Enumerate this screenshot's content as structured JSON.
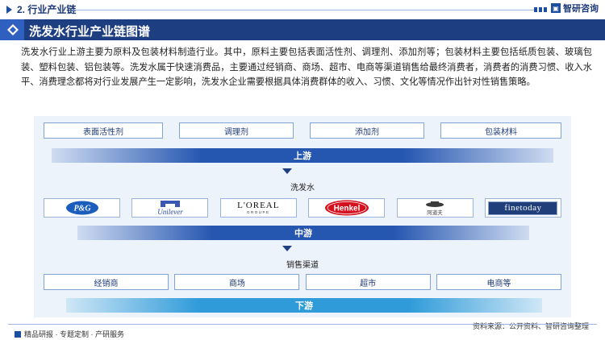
{
  "header": {
    "section_title": "2. 行业产业链",
    "brand": "智研咨询"
  },
  "banner": {
    "title": "洗发水行业产业链图谱"
  },
  "intro": "洗发水行业上游主要为原料及包装材料制造行业。其中，原料主要包括表面活性剂、调理剂、添加剂等；包装材料主要包括纸质包装、玻璃包装、塑料包装、铝包装等。洗发水属于快速消费品，主要通过经销商、商场、超市、电商等渠道销售给最终消费者，消费者的消费习惯、收入水平、消费理念都将对行业发展产生一定影响，洗发水企业需要根据具体消费群体的收入、习惯、文化等情况作出针对性销售策略。",
  "diagram": {
    "upstream_items": [
      "表面活性剂",
      "调理剂",
      "添加剂",
      "包装材料"
    ],
    "upstream_label": "上游",
    "product_label": "洗发水",
    "companies": [
      "P&G",
      "Unilever",
      "L'OREAL",
      "Henkel",
      "阿道夫",
      "finetoday"
    ],
    "company_subtext": {
      "loreal": "GROUPE"
    },
    "midstream_label": "中游",
    "channel_label": "销售渠道",
    "channels": [
      "经销商",
      "商场",
      "超市",
      "电商等"
    ],
    "downstream_label": "下游"
  },
  "footer": {
    "left": "精品研报 · 专题定制 · 产研服务",
    "source": "资料来源：公开资料、智研咨询整理"
  },
  "colors": {
    "primary": "#1e3e82",
    "accent": "#2556b0",
    "panel_bg": "#edf3fb"
  }
}
